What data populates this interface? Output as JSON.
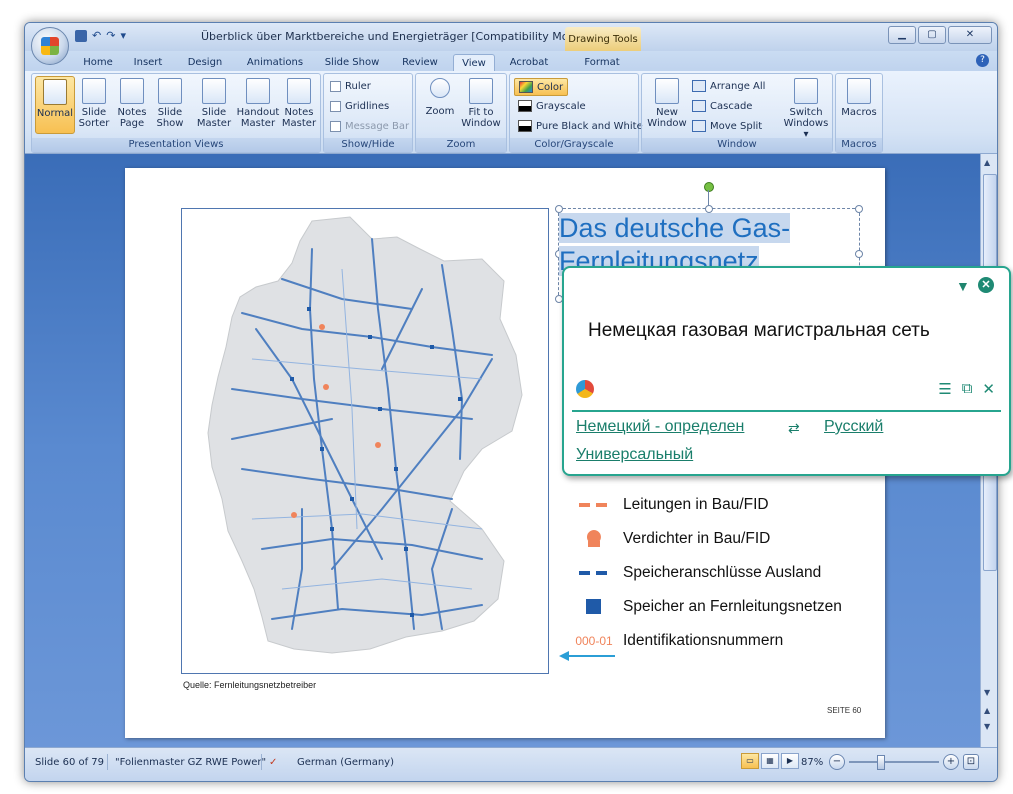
{
  "window": {
    "title": "Überblick über Marktbereiche und Energieträger [Compatibility Mode] - M...",
    "contextual_tab_group": "Drawing Tools",
    "controls": {
      "minimize": "▁",
      "maximize": "▢",
      "close": "✕"
    }
  },
  "quick_access": {
    "undo": "↶",
    "redo": "↷",
    "customize": "▾"
  },
  "tabs": [
    "Home",
    "Insert",
    "Design",
    "Animations",
    "Slide Show",
    "Review",
    "View",
    "Acrobat",
    "Format"
  ],
  "active_tab": "View",
  "help_icon": "?",
  "ribbon": {
    "presentation_views": {
      "label": "Presentation Views",
      "buttons": [
        {
          "l1": "Normal",
          "l2": ""
        },
        {
          "l1": "Slide",
          "l2": "Sorter"
        },
        {
          "l1": "Notes",
          "l2": "Page"
        },
        {
          "l1": "Slide",
          "l2": "Show"
        },
        {
          "l1": "Slide",
          "l2": "Master"
        },
        {
          "l1": "Handout",
          "l2": "Master"
        },
        {
          "l1": "Notes",
          "l2": "Master"
        }
      ]
    },
    "show_hide": {
      "label": "Show/Hide",
      "ruler": "Ruler",
      "gridlines": "Gridlines",
      "message_bar": "Message Bar"
    },
    "zoom": {
      "label": "Zoom",
      "zoom": "Zoom",
      "fit_l1": "Fit to",
      "fit_l2": "Window"
    },
    "color_grayscale": {
      "label": "Color/Grayscale",
      "color": "Color",
      "grayscale": "Grayscale",
      "pure_bw": "Pure Black and White"
    },
    "window": {
      "label": "Window",
      "new_l1": "New",
      "new_l2": "Window",
      "arrange_all": "Arrange All",
      "cascade": "Cascade",
      "move_split": "Move Split",
      "switch_l1": "Switch",
      "switch_l2": "Windows ▾"
    },
    "macros": {
      "label": "Macros",
      "macros": "Macros"
    }
  },
  "slide": {
    "title_line1": "Das deutsche Gas-",
    "title_line2": "Fernleitungsnetz",
    "source": "Quelle: Fernleitungsnetzbetreiber",
    "page": "SEITE 60",
    "legend": [
      {
        "label": "Leitungen in Bau/FID",
        "symbol": "orange-dash"
      },
      {
        "label": "Verdichter in Bau/FID",
        "symbol": "orange-pin"
      },
      {
        "label": "Speicheranschlüsse Ausland",
        "symbol": "blue-dash"
      },
      {
        "label": "Speicher an Fernleitungsnetzen",
        "symbol": "blue-square"
      },
      {
        "label": "Identifikationsnummern",
        "symbol": "id-code",
        "code": "000-01"
      }
    ],
    "colors": {
      "title": "#1f6fc0",
      "orange": "#f0845b",
      "blue": "#1f5aa8",
      "pipeline": "#4f7fc0"
    }
  },
  "translator": {
    "translation": "Немецкая газовая магистральная сеть",
    "source_lang": "Немецкий - определен",
    "target_lang": "Русский",
    "dictionary": "Универсальный",
    "swap_icon": "⇄",
    "pin_icon": "📌",
    "close_icon": "✕"
  },
  "status": {
    "slide_count": "Slide 60 of 79",
    "theme": "\"Folienmaster GZ RWE Power\"",
    "language": "German (Germany)",
    "zoom": "87%",
    "zoom_out": "−",
    "zoom_in": "+"
  }
}
